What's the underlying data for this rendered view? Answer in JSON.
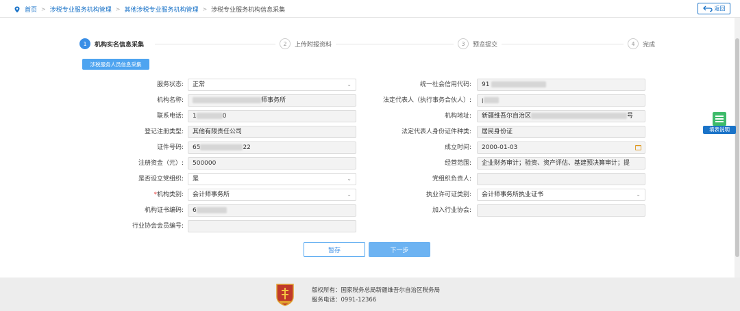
{
  "breadcrumb": {
    "home": "首页",
    "level1": "涉税专业服务机构管理",
    "level2": "其他涉税专业服务机构管理",
    "current": "涉税专业服务机构信息采集"
  },
  "back_button": "返回",
  "steps": [
    {
      "num": "1",
      "label": "机构实名信息采集",
      "active": true
    },
    {
      "num": "2",
      "label": "上传附报资料",
      "active": false
    },
    {
      "num": "3",
      "label": "预览提交",
      "active": false
    },
    {
      "num": "4",
      "label": "完成",
      "active": false
    }
  ],
  "staff_button": "涉税服务人员信息采集",
  "form": {
    "service_status": {
      "label": "服务状态:",
      "value": "正常"
    },
    "credit_code": {
      "label": "统一社会信用代码:",
      "value": "91"
    },
    "org_name": {
      "label": "机构名称:",
      "value": "师事务所"
    },
    "legal_rep": {
      "label": "法定代表人（执行事务合伙人）:",
      "value": "ꞁ"
    },
    "phone": {
      "label": "联系电话:",
      "value_prefix": "1",
      "value_suffix": "0"
    },
    "address": {
      "label": "机构地址:",
      "value_prefix": "新疆维吾尔自治区",
      "value_suffix": "号"
    },
    "reg_type": {
      "label": "登记注册类型:",
      "value": "其他有限责任公司"
    },
    "id_type": {
      "label": "法定代表人身份证件种类:",
      "value": "居民身份证"
    },
    "id_number": {
      "label": "证件号码:",
      "value_prefix": "65",
      "value_suffix": "22"
    },
    "established": {
      "label": "成立时间:",
      "value": "2000-01-03"
    },
    "reg_capital": {
      "label": "注册资金（元）:",
      "value": "500000"
    },
    "business_scope": {
      "label": "经营范围:",
      "value": "企业财务审计；验资、资产评估、基建预决算审计；提"
    },
    "party_org": {
      "label": "是否设立党组织:",
      "value": "是"
    },
    "party_leader": {
      "label": "党组织负责人:",
      "value": ""
    },
    "org_category": {
      "label": "机构类别:",
      "value": "会计师事务所",
      "required": "*"
    },
    "license_type": {
      "label": "执业许可证类别:",
      "value": "会计师事务所执业证书"
    },
    "cert_code": {
      "label": "机构证书编码:",
      "value": "6"
    },
    "industry_assoc": {
      "label": "加入行业协会:",
      "value": ""
    },
    "member_no": {
      "label": "行业协会会员编号:",
      "value": ""
    }
  },
  "buttons": {
    "save": "暂存",
    "next": "下一步"
  },
  "fill_help": "填表说明",
  "footer": {
    "copyright": "版权所有：国家税务总局新疆维吾尔自治区税务局",
    "phone": "服务电话：0991-12366"
  },
  "colors": {
    "accent": "#1a73c8",
    "primary_button": "#6db3f2",
    "footer_bg": "#ededed"
  }
}
